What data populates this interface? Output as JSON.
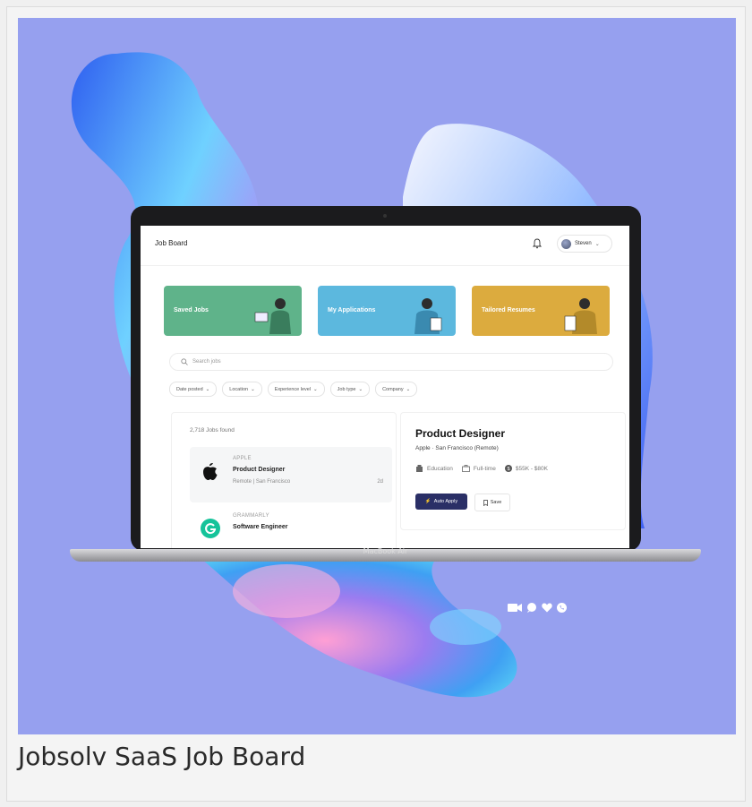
{
  "caption": "Jobsolv SaaS Job Board",
  "laptop_label": "MacBook Air",
  "app": {
    "brand": "Job Board",
    "user_name": "Steven",
    "tiles": [
      {
        "label": "Saved Jobs",
        "color": "#5fb38a"
      },
      {
        "label": "My Applications",
        "color": "#5cb8de"
      },
      {
        "label": "Tailored Resumes",
        "color": "#dcab3e"
      }
    ],
    "search_placeholder": "Search jobs",
    "filters": [
      "Date posted",
      "Location",
      "Experience level",
      "Job type",
      "Company"
    ],
    "jobs_count": "2,718 Jobs found",
    "jobs": [
      {
        "company": "APPLE",
        "title": "Product Designer",
        "location": "Remote | San Francisco",
        "age": "2d"
      },
      {
        "company": "GRAMMARLY",
        "title": "Software Engineer",
        "location": "",
        "age": ""
      }
    ],
    "detail": {
      "title": "Product Designer",
      "subtitle": "Apple · San Francisco (Remote)",
      "industry": "Education",
      "job_type": "Full-time",
      "salary": "$55K - $80K",
      "auto_apply_label": "Auto Apply",
      "save_label": "Save"
    }
  },
  "colors": {
    "background": "#96a0ef",
    "primary_button": "#2a2f66"
  }
}
